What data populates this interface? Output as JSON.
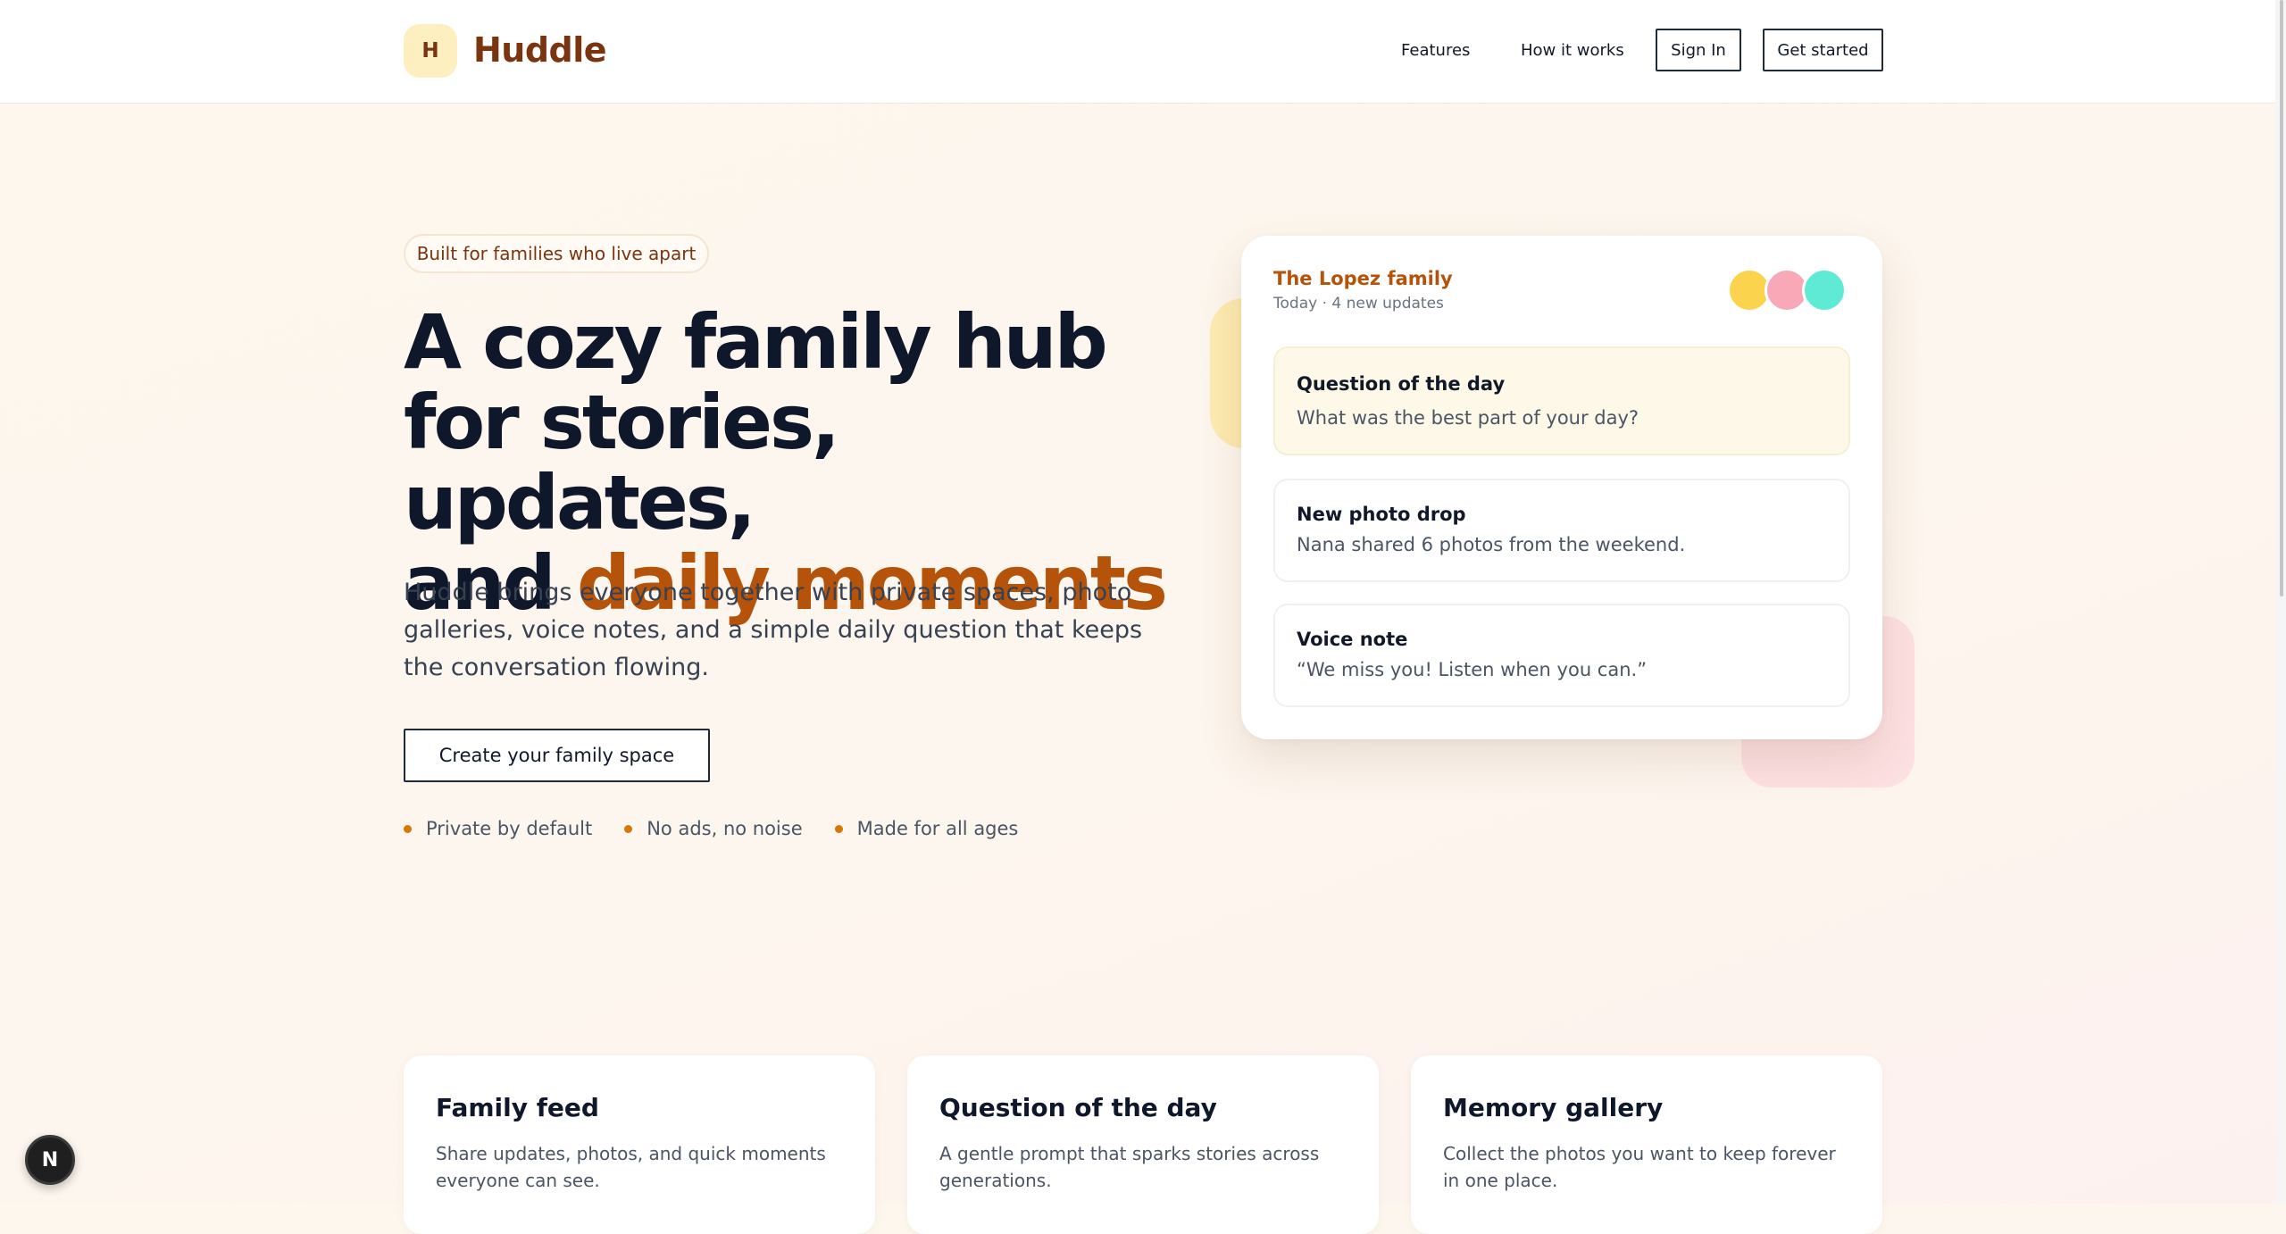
{
  "header": {
    "logo_letter": "H",
    "brand": "Huddle",
    "nav": {
      "features": "Features",
      "how_it_works": "How it works",
      "sign_in": "Sign In",
      "get_started": "Get started"
    }
  },
  "hero": {
    "pill": "Built for families who live apart",
    "title_line1": "A cozy family hub",
    "title_line2": "for stories, updates,",
    "title_line3_prefix": "and ",
    "title_line3_accent": "daily moments",
    "subtitle": "Huddle brings everyone together with private spaces, photo galleries, voice notes, and a simple daily question that keeps the conversation flowing.",
    "cta": "Create your family space",
    "features": [
      "Private by default",
      "No ads, no noise",
      "Made for all ages"
    ]
  },
  "family_card": {
    "family_name": "The Lopez family",
    "meta": "Today · 4 new updates",
    "avatar_colors": [
      "#fcd34d",
      "#f9a8b8",
      "#5eead4"
    ],
    "updates": [
      {
        "title": "Question of the day",
        "body": "What was the best part of your day?"
      },
      {
        "title": "New photo drop",
        "body": "Nana shared 6 photos from the weekend."
      },
      {
        "title": "Voice note",
        "body": "“We miss you! Listen when you can.”"
      }
    ]
  },
  "feature_cards": [
    {
      "title": "Family feed",
      "body": "Share updates, photos, and quick moments everyone can see."
    },
    {
      "title": "Question of the day",
      "body": "A gentle prompt that sparks stories across generations."
    },
    {
      "title": "Memory gallery",
      "body": "Collect the photos you want to keep forever in one place."
    }
  ],
  "dev_badge": "N",
  "colors": {
    "brand": "#7a3510",
    "accent": "#b45309",
    "dot": "#d97706"
  }
}
